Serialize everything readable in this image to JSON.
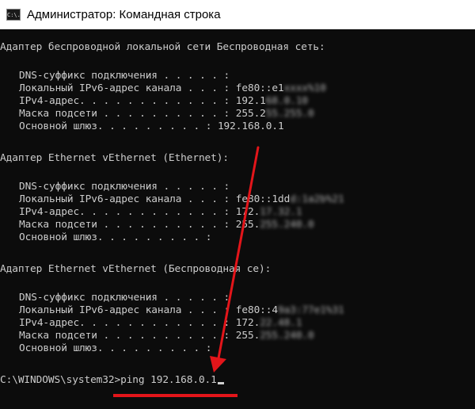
{
  "window": {
    "title": "Администратор: Командная строка",
    "icon": "cmd-icon",
    "icon_glyph": "C:\\."
  },
  "adapters": [
    {
      "header": "Адаптер беспроводной локальной сети Беспроводная сеть:",
      "rows": [
        {
          "label": "DNS-суффикс подключения . . . . . :",
          "value": ""
        },
        {
          "label": "Локальный IPv6-адрес канала . . . :",
          "value": "fe80::e1",
          "blurred": "xxxx%10"
        },
        {
          "label": "IPv4-адрес. . . . . . . . . . . . :",
          "value": "192.1",
          "blurred": "68.0.10"
        },
        {
          "label": "Маска подсети . . . . . . . . . . :",
          "value": "255.2",
          "blurred": "55.255.0"
        },
        {
          "label": "Основной шлюз. . . . . . . . . :",
          "value": "192.168.0.1"
        }
      ]
    },
    {
      "header": "Адаптер Ethernet vEthernet (Ethernet):",
      "rows": [
        {
          "label": "DNS-суффикс подключения . . . . . :",
          "value": ""
        },
        {
          "label": "Локальный IPv6-адрес канала . . . :",
          "value": "fe80::1dd",
          "blurred": "d:1a2b%21"
        },
        {
          "label": "IPv4-адрес. . . . . . . . . . . . :",
          "value": "172.",
          "blurred": "17.32.1"
        },
        {
          "label": "Маска подсети . . . . . . . . . . :",
          "value": "255.",
          "blurred": "255.240.0"
        },
        {
          "label": "Основной шлюз. . . . . . . . . :",
          "value": ""
        }
      ]
    },
    {
      "header": "Адаптер Ethernet vEthernet (Беспроводная се):",
      "rows": [
        {
          "label": "DNS-суффикс подключения . . . . . :",
          "value": ""
        },
        {
          "label": "Локальный IPv6-адрес канала . . . :",
          "value": "fe80::4",
          "blurred": "9a3:77e1%31"
        },
        {
          "label": "IPv4-адрес. . . . . . . . . . . . :",
          "value": "172.",
          "blurred": "22.48.1"
        },
        {
          "label": "Маска подсети . . . . . . . . . . :",
          "value": "255.",
          "blurred": "255.240.0"
        },
        {
          "label": "Основной шлюз. . . . . . . . . :",
          "value": ""
        }
      ]
    }
  ],
  "prompt": {
    "path": "C:\\WINDOWS\\system32>",
    "command": "ping 192.168.0.1"
  },
  "annotation": {
    "color": "#e3151a"
  }
}
